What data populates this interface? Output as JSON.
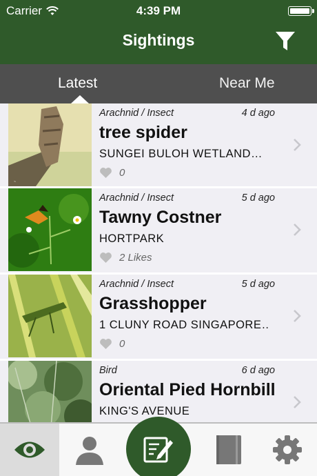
{
  "status_bar": {
    "carrier": "Carrier",
    "time": "4:39 PM"
  },
  "nav": {
    "title": "Sightings",
    "filter_icon": "filter-icon"
  },
  "tabs": [
    {
      "label": "Latest",
      "selected": true
    },
    {
      "label": "Near Me",
      "selected": false
    }
  ],
  "sightings": [
    {
      "category": "Arachnid / Insect",
      "age": "4 d ago",
      "name": "tree spider",
      "location": "SUNGEI BULOH WETLAND…",
      "likes": "0"
    },
    {
      "category": "Arachnid / Insect",
      "age": "5 d ago",
      "name": "Tawny Costner",
      "location": "HORTPARK",
      "likes": "2 Likes"
    },
    {
      "category": "Arachnid / Insect",
      "age": "5 d ago",
      "name": "Grasshopper",
      "location": "1 CLUNY ROAD SINGAPORE…",
      "likes": "0"
    },
    {
      "category": "Bird",
      "age": "6 d ago",
      "name": "Oriental Pied Hornbill",
      "location": "KING'S AVENUE",
      "likes": ""
    }
  ],
  "tab_bar": [
    {
      "icon": "eye-icon",
      "active": true
    },
    {
      "icon": "profile-icon",
      "active": false
    },
    {
      "icon": "compose-icon",
      "active": false
    },
    {
      "icon": "book-icon",
      "active": false
    },
    {
      "icon": "gear-icon",
      "active": false
    }
  ],
  "colors": {
    "brand_green": "#2f5a2a",
    "tab_gray": "#4f4f4f",
    "row_bg": "#f0eff4"
  }
}
